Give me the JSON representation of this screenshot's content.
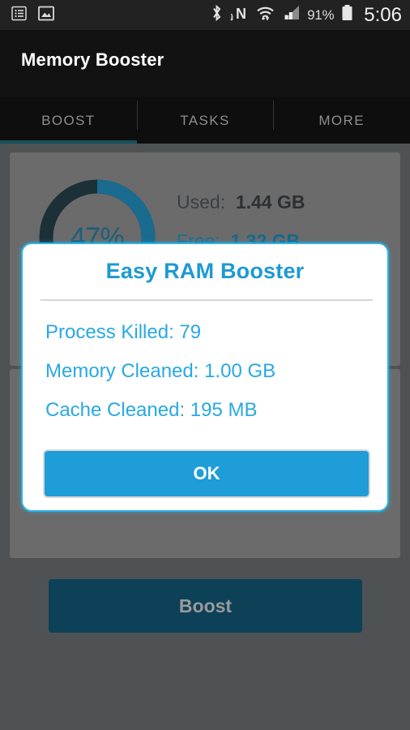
{
  "statusbar": {
    "left_icons": [
      "list-view-icon",
      "image-icon"
    ],
    "right_icons": [
      "bluetooth-icon",
      "nfc-icon",
      "wifi-icon",
      "signal-icon",
      "battery-icon"
    ],
    "battery_percent": "91%",
    "clock": "5:06"
  },
  "actionbar": {
    "title": "Memory Booster"
  },
  "tabs": [
    {
      "label": "BOOST",
      "active": true
    },
    {
      "label": "TASKS",
      "active": false
    },
    {
      "label": "MORE",
      "active": false
    }
  ],
  "memory_card": {
    "gauge_percent": "47%",
    "gauge_value": 47,
    "used_label": "Used:",
    "used_value": "1.44 GB",
    "free_label": "Free:",
    "free_value": "1.32 GB"
  },
  "boost": {
    "label": "Boost"
  },
  "dialog": {
    "title": "Easy RAM Booster",
    "lines": [
      "Process Killed: 79",
      "Memory Cleaned: 1.00 GB",
      "Cache Cleaned: 195 MB"
    ],
    "ok_label": "OK"
  },
  "colors": {
    "accent_blue": "#29a9e0",
    "dialog_border": "#2bb3e8",
    "title_blue": "#1d9ad2",
    "gauge_track": "#1c3038",
    "gauge_fill": "#15688c",
    "boost_button": "#0d4158",
    "tab_indicator": "#155157",
    "card_bg": "#6b6b6b",
    "scrim_bg": "#4e5255"
  }
}
